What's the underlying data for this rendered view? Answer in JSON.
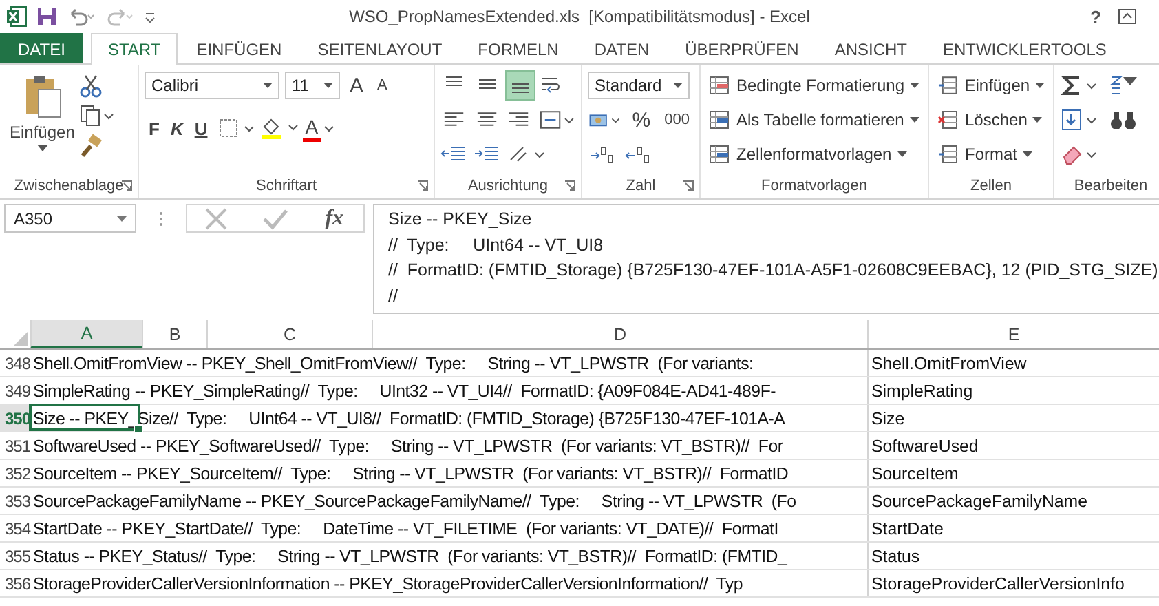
{
  "window": {
    "title": "WSO_PropNamesExtended.xls  [Kompatibilitätsmodus] - Excel",
    "help": "?"
  },
  "tabs": [
    {
      "label": "DATEI",
      "kind": "file",
      "selected": false
    },
    {
      "label": "START",
      "kind": "tab",
      "selected": true
    },
    {
      "label": "EINFÜGEN",
      "kind": "tab",
      "selected": false
    },
    {
      "label": "SEITENLAYOUT",
      "kind": "tab",
      "selected": false
    },
    {
      "label": "FORMELN",
      "kind": "tab",
      "selected": false
    },
    {
      "label": "DATEN",
      "kind": "tab",
      "selected": false
    },
    {
      "label": "ÜBERPRÜFEN",
      "kind": "tab",
      "selected": false
    },
    {
      "label": "ANSICHT",
      "kind": "tab",
      "selected": false
    },
    {
      "label": "ENTWICKLERTOOLS",
      "kind": "tab",
      "selected": false
    }
  ],
  "ribbon": {
    "clipboard": {
      "label": "Zwischenablage",
      "paste": "Einfügen"
    },
    "font": {
      "label": "Schriftart",
      "font_name": "Calibri",
      "font_size": "11",
      "grow": "A",
      "shrink": "A",
      "bold": "F",
      "italic": "K",
      "underline": "U",
      "font_color": "A"
    },
    "alignment": {
      "label": "Ausrichtung",
      "vertical": [
        {
          "selected": false
        },
        {
          "selected": false
        },
        {
          "selected": true
        }
      ]
    },
    "number": {
      "label": "Zahl",
      "format": "Standard",
      "percent": "%",
      "thousands": "000"
    },
    "styles": {
      "label": "Formatvorlagen",
      "items": [
        "Bedingte Formatierung",
        "Als Tabelle formatieren",
        "Zellenformatvorlagen"
      ]
    },
    "cells": {
      "label": "Zellen",
      "items": [
        "Einfügen",
        "Löschen",
        "Format"
      ]
    },
    "editing": {
      "label": "Bearbeiten"
    }
  },
  "formula_bar": {
    "name_box": "A350",
    "fx": "fx",
    "lines": [
      "Size -- PKEY_Size",
      "//  Type:     UInt64 -- VT_UI8",
      "//  FormatID: (FMTID_Storage) {B725F130-47EF-101A-A5F1-02608C9EEBAC}, 12 (PID_STG_SIZE)",
      "//"
    ]
  },
  "columns": [
    {
      "label": "A",
      "selected": true
    },
    {
      "label": "B",
      "selected": false
    },
    {
      "label": "C",
      "selected": false
    },
    {
      "label": "D",
      "selected": false
    },
    {
      "label": "E",
      "selected": false
    }
  ],
  "rows": [
    {
      "number": "348",
      "selected": false,
      "text": "Shell.OmitFromView -- PKEY_Shell_OmitFromView//  Type:     String -- VT_LPWSTR  (For variants:",
      "e": "Shell.OmitFromView"
    },
    {
      "number": "349",
      "selected": false,
      "text": "SimpleRating -- PKEY_SimpleRating//  Type:     UInt32 -- VT_UI4//  FormatID: {A09F084E-AD41-489F-",
      "e": "SimpleRating"
    },
    {
      "number": "350",
      "selected": true,
      "text": "Size -- PKEY_Size//  Type:     UInt64 -- VT_UI8//  FormatID: (FMTID_Storage) {B725F130-47EF-101A-A",
      "e": "Size"
    },
    {
      "number": "351",
      "selected": false,
      "text": "SoftwareUsed -- PKEY_SoftwareUsed//  Type:     String -- VT_LPWSTR  (For variants: VT_BSTR)//  For",
      "e": "SoftwareUsed"
    },
    {
      "number": "352",
      "selected": false,
      "text": "SourceItem -- PKEY_SourceItem//  Type:     String -- VT_LPWSTR  (For variants: VT_BSTR)//  FormatID",
      "e": "SourceItem"
    },
    {
      "number": "353",
      "selected": false,
      "text": "SourcePackageFamilyName -- PKEY_SourcePackageFamilyName//  Type:     String -- VT_LPWSTR  (Fo",
      "e": "SourcePackageFamilyName"
    },
    {
      "number": "354",
      "selected": false,
      "text": "StartDate -- PKEY_StartDate//  Type:     DateTime -- VT_FILETIME  (For variants: VT_DATE)//  FormatI",
      "e": "StartDate"
    },
    {
      "number": "355",
      "selected": false,
      "text": "Status -- PKEY_Status//  Type:     String -- VT_LPWSTR  (For variants: VT_BSTR)//  FormatID: (FMTID_",
      "e": "Status"
    },
    {
      "number": "356",
      "selected": false,
      "text": "StorageProviderCallerVersionInformation -- PKEY_StorageProviderCallerVersionInformation//  Typ",
      "e": "StorageProviderCallerVersionInfo"
    }
  ]
}
